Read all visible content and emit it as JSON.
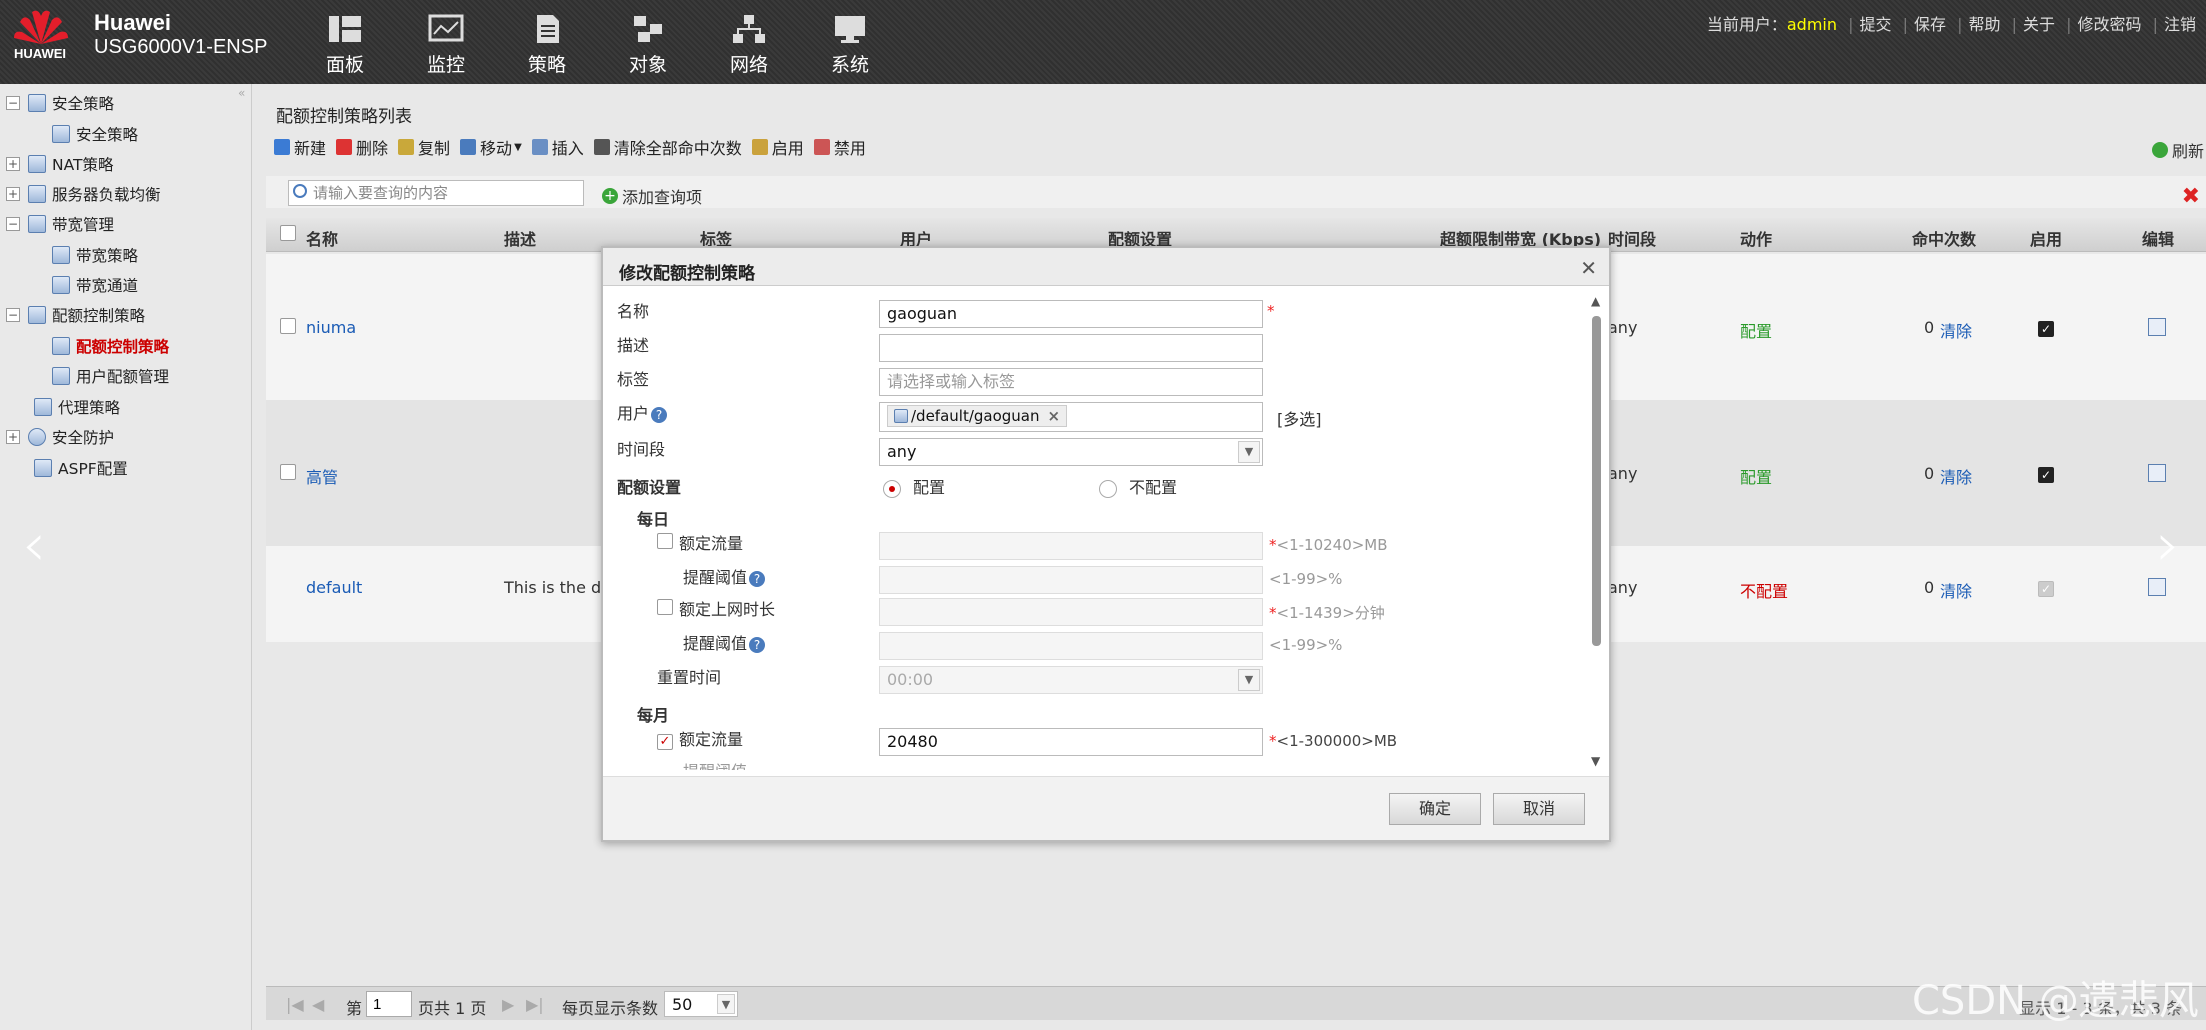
{
  "header": {
    "brand": "Huawei",
    "model": "USG6000V1-ENSP",
    "logo_text": "HUAWEI",
    "nav": [
      {
        "label": "面板",
        "icon": "dashboard-icon"
      },
      {
        "label": "监控",
        "icon": "monitor-icon"
      },
      {
        "label": "策略",
        "icon": "policy-icon"
      },
      {
        "label": "对象",
        "icon": "object-icon"
      },
      {
        "label": "网络",
        "icon": "network-icon"
      },
      {
        "label": "系统",
        "icon": "system-icon"
      }
    ],
    "current_user_label": "当前用户：",
    "current_user": "admin",
    "links": [
      "提交",
      "保存",
      "帮助",
      "关于",
      "修改密码",
      "注销"
    ]
  },
  "sidebar": {
    "items": [
      {
        "label": "安全策略"
      },
      {
        "label": "安全策略"
      },
      {
        "label": "NAT策略"
      },
      {
        "label": "服务器负载均衡"
      },
      {
        "label": "带宽管理"
      },
      {
        "label": "带宽策略"
      },
      {
        "label": "带宽通道"
      },
      {
        "label": "配额控制策略"
      },
      {
        "label": "配额控制策略"
      },
      {
        "label": "用户配额管理"
      },
      {
        "label": "代理策略"
      },
      {
        "label": "安全防护"
      },
      {
        "label": "ASPF配置"
      }
    ]
  },
  "main": {
    "title": "配额控制策略列表",
    "toolbar": [
      "新建",
      "删除",
      "复制",
      "移动",
      "插入",
      "清除全部命中次数",
      "启用",
      "禁用"
    ],
    "refresh": "刷新",
    "search_placeholder": "请输入要查询的内容",
    "add_query": "添加查询项",
    "columns": [
      "名称",
      "描述",
      "标签",
      "用户",
      "配额设置",
      "超额限制带宽 (Kbps)",
      "时间段",
      "动作",
      "命中次数",
      "启用",
      "编辑"
    ],
    "rows": [
      {
        "name": "niuma",
        "desc": "",
        "time": "any",
        "action": "配置",
        "hits": "0",
        "clear": "清除"
      },
      {
        "name": "高管",
        "desc": "",
        "time": "any",
        "action": "配置",
        "hits": "0",
        "clear": "清除"
      },
      {
        "name": "default",
        "desc": "This is the def",
        "time": "any",
        "action": "不配置",
        "hits": "0",
        "clear": "清除"
      }
    ],
    "pager": {
      "page_label": "第",
      "page": "1",
      "total": "页共 1 页",
      "per_page_label": "每页显示条数",
      "per_page": "50",
      "summary": "显示 1 - 3 条，共 3 条"
    }
  },
  "dialog": {
    "title": "修改配额控制策略",
    "name_label": "名称",
    "name_value": "gaoguan",
    "desc_label": "描述",
    "tag_label": "标签",
    "tag_placeholder": "请选择或输入标签",
    "user_label": "用户",
    "user_value": "/default/gaoguan",
    "multi_select": "[多选]",
    "time_label": "时间段",
    "time_value": "any",
    "quota_label": "配额设置",
    "quota_on": "配置",
    "quota_off": "不配置",
    "daily": "每日",
    "daily_traffic": "额定流量",
    "daily_traffic_hint": "<1-10240>MB",
    "daily_threshold": "提醒阈值",
    "daily_threshold_hint": "<1-99>%",
    "daily_online": "额定上网时长",
    "daily_online_hint": "<1-1439>分钟",
    "daily_online_threshold": "提醒阈值",
    "daily_online_threshold_hint": "<1-99>%",
    "reset_time": "重置时间",
    "reset_value": "00:00",
    "monthly": "每月",
    "monthly_traffic": "额定流量",
    "monthly_traffic_value": "20480",
    "monthly_traffic_hint": "<1-300000>MB",
    "monthly_threshold": "提醒阈值",
    "ok": "确定",
    "cancel": "取消"
  },
  "watermark": "CSDN @遗悲风"
}
